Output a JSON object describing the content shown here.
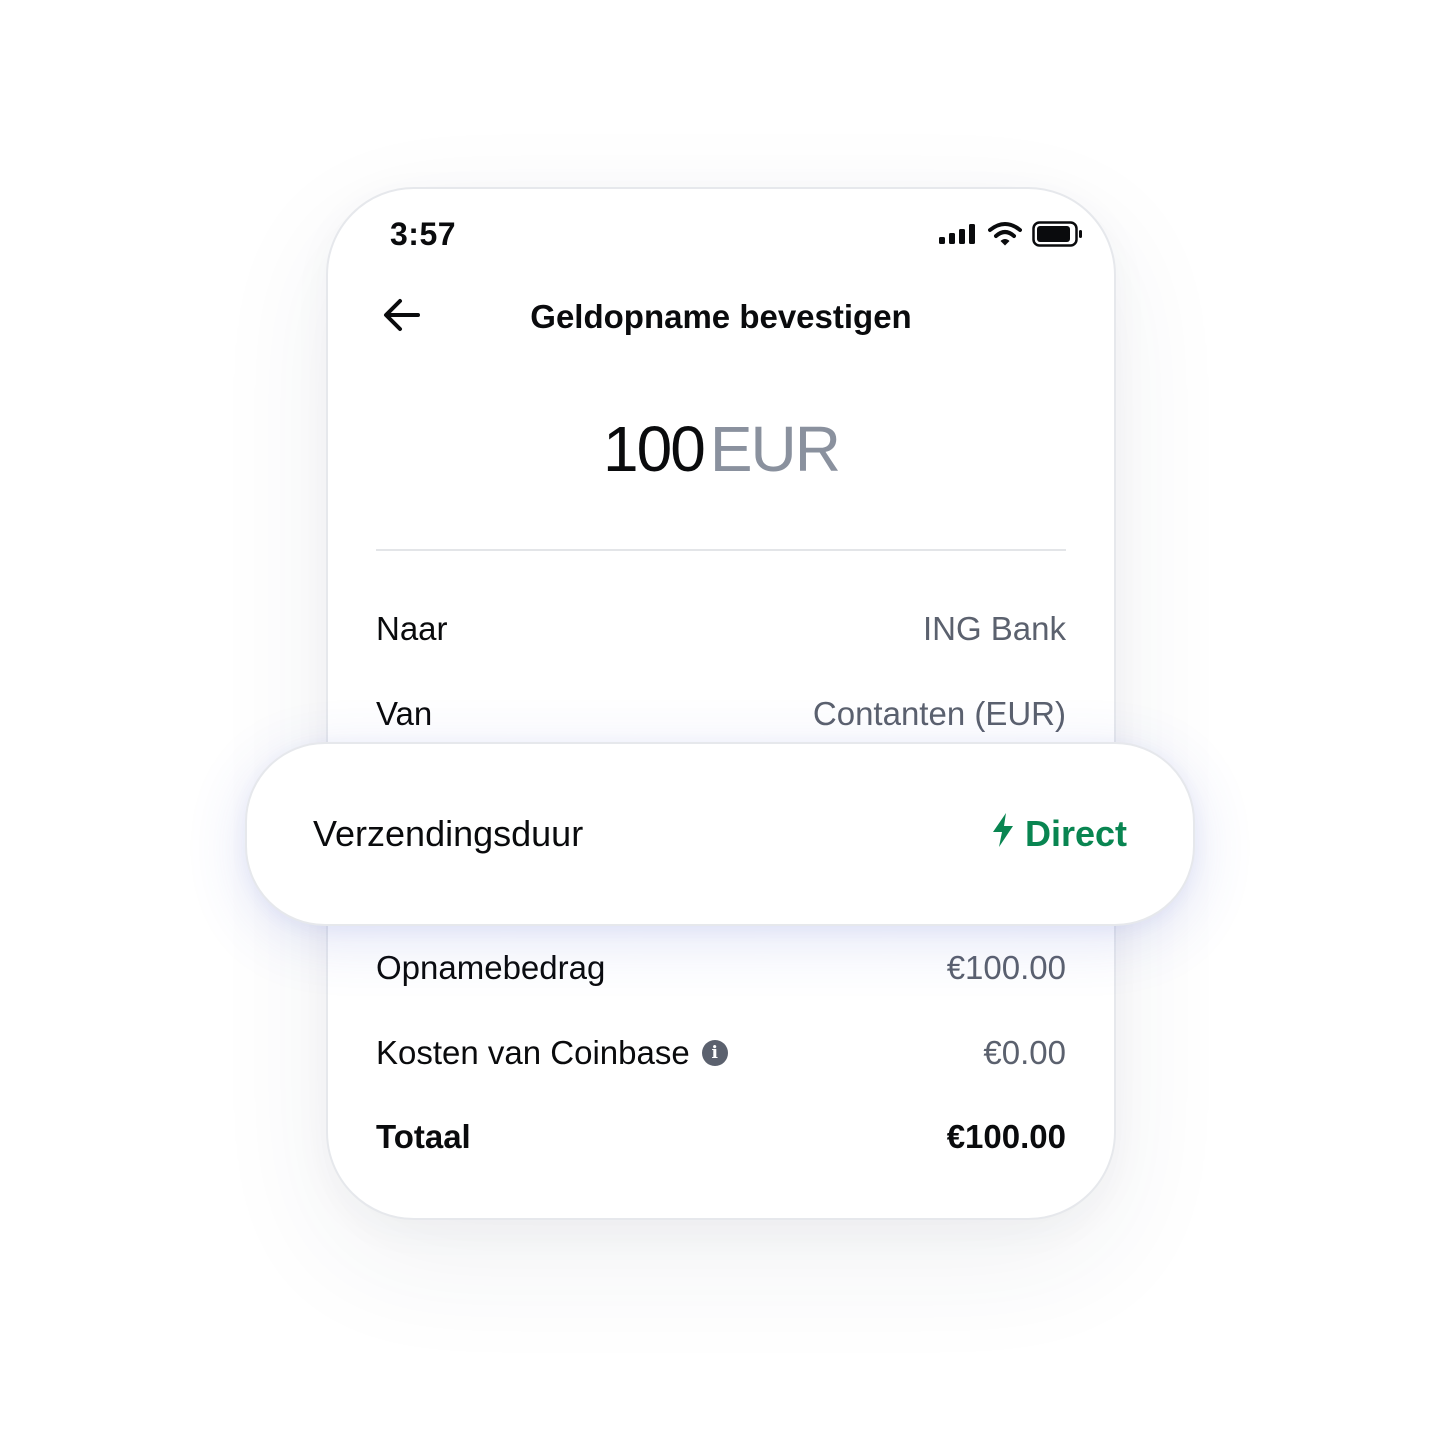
{
  "status_bar": {
    "time": "3:57",
    "icons": [
      "signal-icon",
      "wifi-icon",
      "battery-icon"
    ]
  },
  "header": {
    "back_icon": "arrow-left-icon",
    "title": "Geldopname bevestigen"
  },
  "amount": {
    "value": "100",
    "currency": "EUR"
  },
  "details": {
    "to_label": "Naar",
    "to_value": "ING Bank",
    "from_label": "Van",
    "from_value": "Contanten (EUR)",
    "transfer_time_label": "Verzendingsduur",
    "transfer_time_value": "Direct",
    "withdraw_amount_label": "Opnamebedrag",
    "withdraw_amount_value": "€100.00",
    "fee_label": "Kosten van Coinbase",
    "fee_info_icon": "info-icon",
    "fee_value": "€0.00",
    "total_label": "Totaal",
    "total_value": "€100.00"
  },
  "colors": {
    "primary_text": "#0a0b0d",
    "secondary_text": "#5b616e",
    "muted_currency": "#8a919e",
    "positive_green": "#098551"
  }
}
